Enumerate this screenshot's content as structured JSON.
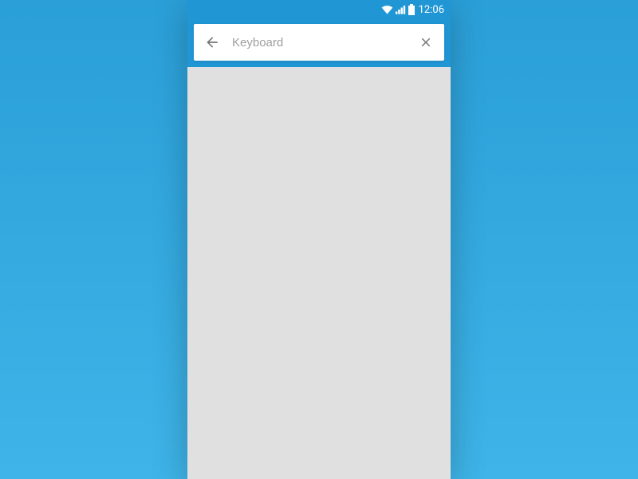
{
  "status_bar": {
    "time": "12:06"
  },
  "search": {
    "placeholder": "Keyboard",
    "value": ""
  }
}
